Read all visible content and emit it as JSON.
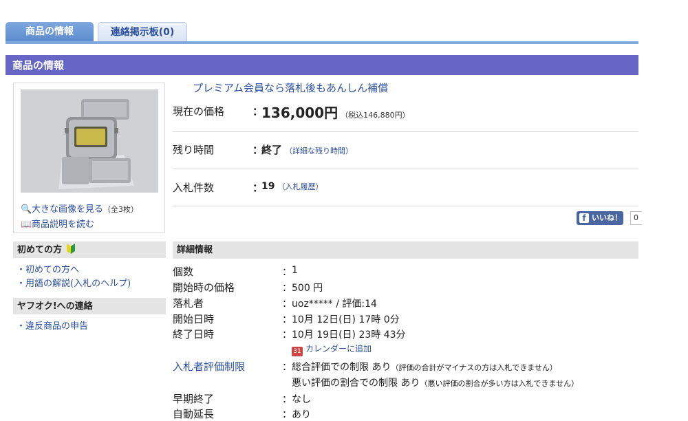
{
  "tabs": [
    {
      "label": "商品の情報"
    },
    {
      "label": "連絡掲示板(0)"
    }
  ],
  "section_title": "商品の情報",
  "image_box": {
    "view_large_label": "大きな画像を見る",
    "image_count": "（全3枚）",
    "read_description_label": "商品説明を読む"
  },
  "sidebar": {
    "beginners": {
      "title": "初めての方",
      "items": [
        "・初めての方へ",
        "・用語の解説(入札のヘルプ)"
      ]
    },
    "contact": {
      "title": "ヤフオク!への連絡",
      "items": [
        "・違反商品の申告"
      ]
    }
  },
  "promo_link": "プレミアム会員なら落札後もあんしん補償",
  "price": {
    "label": "現在の価格",
    "colon": "：",
    "value": "136,000円",
    "tax_note": "（税込146,880円）"
  },
  "remaining": {
    "label": "残り時間",
    "value": "終了",
    "link": "（詳細な残り時間）"
  },
  "bids": {
    "label": "入札件数",
    "value": "19",
    "link": "（入札履歴）"
  },
  "facebook": {
    "like_label": "いいね！",
    "count": "0"
  },
  "details": {
    "title": "詳細情報",
    "colon": "：",
    "quantity": {
      "label": "個数",
      "value": "1"
    },
    "start_price": {
      "label": "開始時の価格",
      "value": "500 円"
    },
    "winner": {
      "label": "落札者",
      "value": "uoz***** / 評価:14"
    },
    "start_date": {
      "label": "開始日時",
      "value": "10月 12日(日) 17時 0分"
    },
    "end_date": {
      "label": "終了日時",
      "value": "10月 19日(日) 23時 43分"
    },
    "calendar_link": "カレンダーに追加",
    "bidder_restriction": {
      "label": "入札者評価制限",
      "value1": "総合評価での制限 あり",
      "note1": "（評価の合計がマイナスの方は入札できません）",
      "value2": "悪い評価の割合での制限 あり",
      "note2": "（悪い評価の割合が多い方は入札できません）"
    },
    "early_end": {
      "label": "早期終了",
      "value": "なし"
    },
    "auto_extend": {
      "label": "自動延長",
      "value": "あり"
    }
  }
}
